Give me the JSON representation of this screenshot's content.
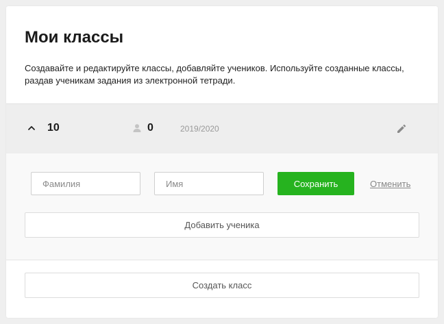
{
  "header": {
    "title": "Мои классы",
    "description": "Создавайте и редактируйте классы, добавляйте учеников. Используйте созданные классы, раздав ученикам задания из электронной тетради."
  },
  "class_row": {
    "name": "10",
    "student_count": "0",
    "year": "2019/2020",
    "icons": {
      "collapse": "chevron-up-icon",
      "students": "person-icon",
      "edit": "pencil-icon"
    }
  },
  "form": {
    "lastname_placeholder": "Фамилия",
    "lastname_value": "",
    "firstname_placeholder": "Имя",
    "firstname_value": "",
    "save_label": "Сохранить",
    "cancel_label": "Отменить",
    "add_student_label": "Добавить ученика"
  },
  "footer": {
    "create_class_label": "Создать класс"
  },
  "colors": {
    "accent_green": "#26b31f",
    "row_background": "#eeeeee",
    "form_background": "#f9f9f9"
  }
}
